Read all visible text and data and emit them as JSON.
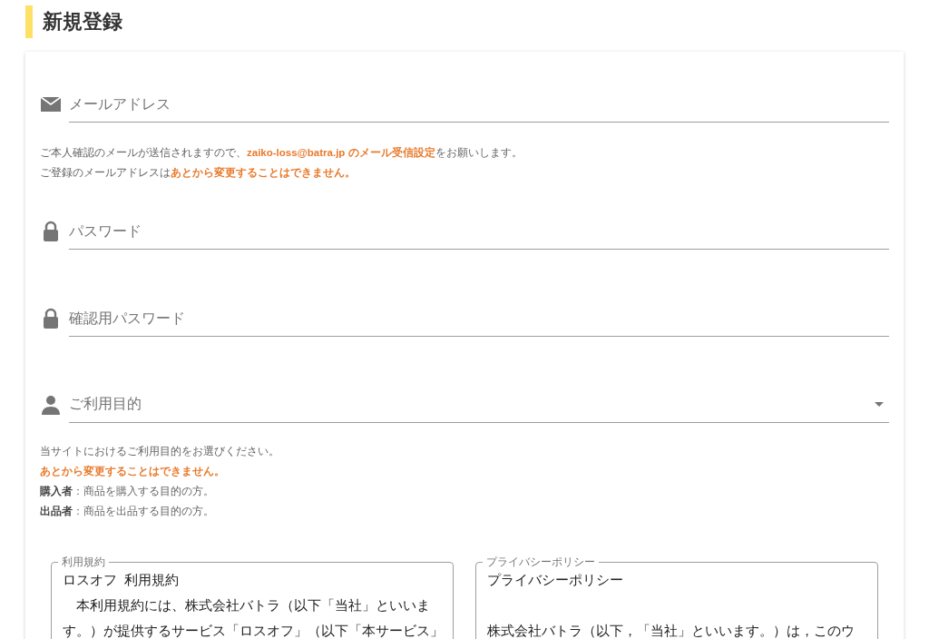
{
  "title": "新規登録",
  "sections": [
    {
      "field": {
        "kind": "email",
        "placeholder": "メールアドレス"
      },
      "notes": [
        {
          "kind": "accent",
          "text": "ご本人確認のメールが送信されますので、**zaiko-loss@batra.jp のメール受信設定**をお願いします。"
        },
        {
          "kind": "accent",
          "text": "ご登録のメールアドレスは**あとから変更することはできません。**"
        }
      ]
    },
    {
      "field": {
        "kind": "password",
        "placeholder": "パスワード"
      }
    },
    {
      "field": {
        "kind": "password",
        "placeholder": "確認用パスワード"
      }
    },
    {
      "field": {
        "kind": "select",
        "placeholder": "ご利用目的"
      },
      "notes": [
        {
          "kind": "plain",
          "text": "当サイトにおけるご利用目的をお選びください。"
        },
        {
          "kind": "warning",
          "text": "あとから変更することはできません。"
        },
        {
          "kind": "term",
          "text": "**購入者**：商品を購入する目的の方。"
        },
        {
          "kind": "term",
          "text": "**出品者**：商品を出品する目的の方。"
        }
      ]
    }
  ],
  "documents": [
    {
      "legend": "利用規約",
      "paragraphs": [
        {
          "text": "ロスオフ  利用規約",
          "blank_line_before": false
        },
        {
          "text": "　本利用規約には、株式会社バトラ（以下「当社」といいます。）が提供するサービス「ロスオフ」（以下「本サービス」",
          "blank_line_before": false
        }
      ]
    },
    {
      "legend": "プライバシーポリシー",
      "paragraphs": [
        {
          "text": "プライバシーポリシー",
          "blank_line_before": false
        },
        {
          "text": "株式会社バトラ（以下，「当社」といいます。）は，このウ",
          "blank_line_before": true
        }
      ]
    }
  ]
}
